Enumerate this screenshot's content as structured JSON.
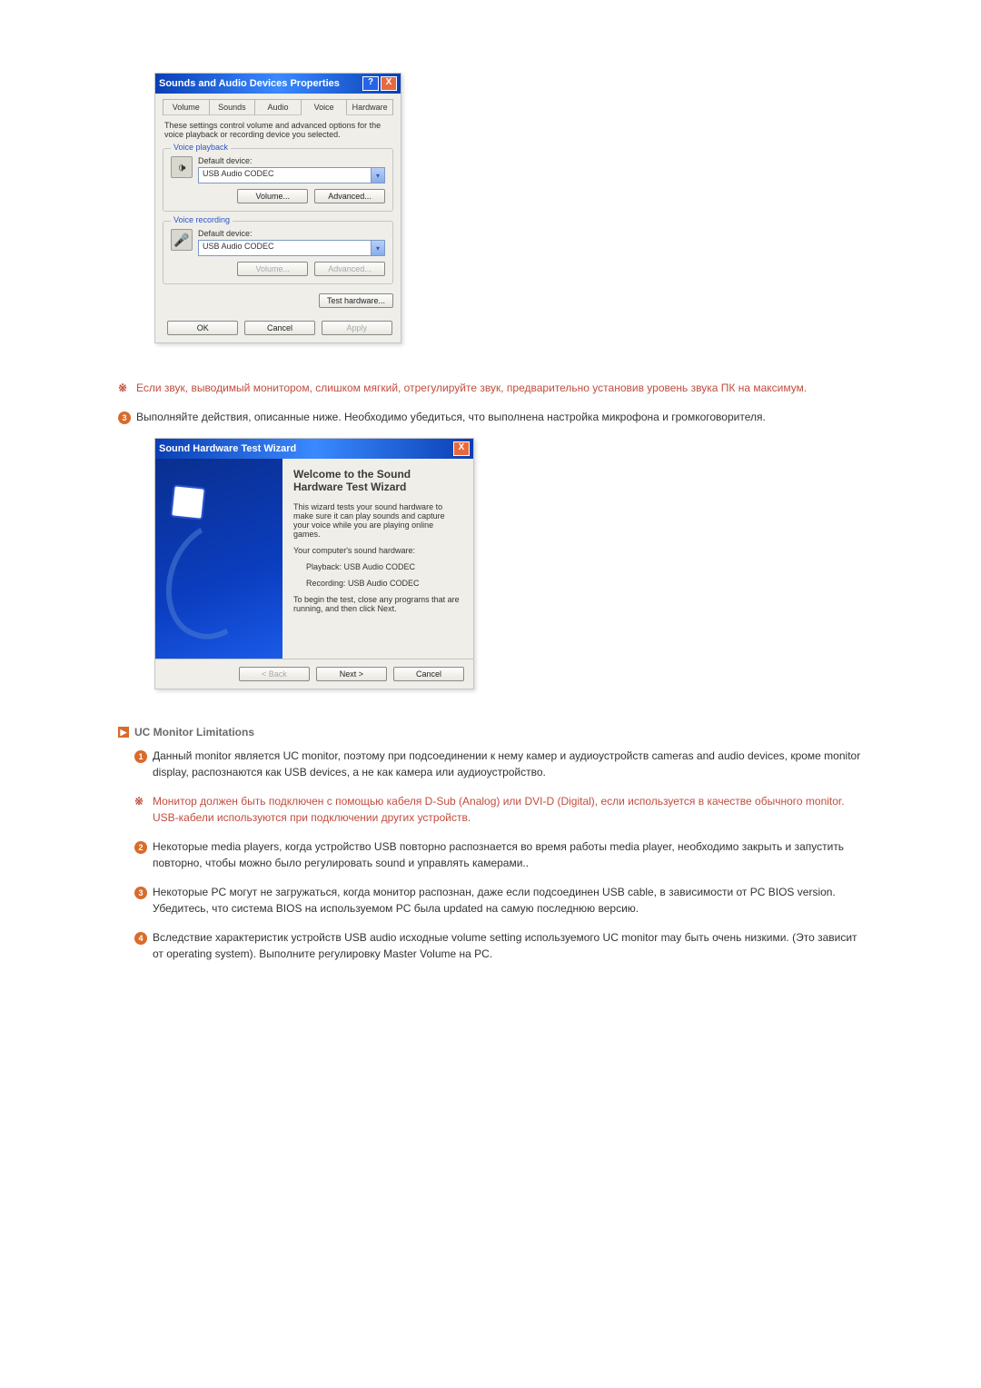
{
  "dialog1": {
    "title": "Sounds and Audio Devices Properties",
    "tabs": {
      "t0": "Volume",
      "t1": "Sounds",
      "t2": "Audio",
      "t3": "Voice",
      "t4": "Hardware"
    },
    "desc": "These settings control volume and advanced options for the voice playback or recording device you selected.",
    "sec_playback": {
      "legend": "Voice playback",
      "label": "Default device:",
      "value": "USB Audio CODEC",
      "btn_volume": "Volume...",
      "btn_advanced": "Advanced..."
    },
    "sec_recording": {
      "legend": "Voice recording",
      "label": "Default device:",
      "value": "USB Audio CODEC",
      "btn_volume": "Volume...",
      "btn_advanced": "Advanced..."
    },
    "test_hw": "Test hardware...",
    "ok": "OK",
    "cancel": "Cancel",
    "apply": "Apply"
  },
  "note_red_1": "Если звук, выводимый монитором, слишком мягкий, отрегулируйте звук, предварительно установив уровень звука ПК на максимум.",
  "step3": "Выполняйте действия, описанные ниже. Необходимо убедиться, что выполнена настройка микрофона и громкоговорителя.",
  "wizard": {
    "title": "Sound Hardware Test Wizard",
    "heading": "Welcome to the Sound Hardware Test Wizard",
    "p1": "This wizard tests your sound hardware to make sure it can play sounds and capture your voice while you are playing online games.",
    "p2": "Your computer's sound hardware:",
    "pb": "Playback:  USB Audio CODEC",
    "rc": "Recording:  USB Audio CODEC",
    "p3": "To begin the test, close any programs that are running, and then click Next.",
    "back": "< Back",
    "next": "Next >",
    "cancel": "Cancel"
  },
  "section_header": "UC Monitor Limitations",
  "limit1": "Данный monitor является UC monitor, поэтому при подсоединении к нему камер и аудиоустройств cameras and audio devices, кроме monitor display, распознаются как USB devices, а не как камера или аудиоустройство.",
  "limit_red": "Монитор должен быть подключен с помощью кабеля D-Sub (Analog) или DVI-D (Digital), если используется в качестве обычного monitor. USB-кабели используются при подключении других устройств.",
  "limit2": "Некоторые media players, когда устройство USB повторно распознается во время работы media player, необходимо закрыть и запустить повторно, чтобы можно было регулировать sound и управлять камерами..",
  "limit3": "Некоторые PC могут не загружаться, когда монитор распознан, даже если подсоединен USB cable, в зависимости от PC BIOS version.\nУбедитесь, что система BIOS на используемом PC была updated на самую последнюю версию.",
  "limit4": "Вследствие характеристик устройств USB audio исходные volume setting используемого UC monitor may быть очень низкими. (Это зависит от operating system). Выполните регулировку Master Volume на PC.",
  "icons": {
    "help": "?",
    "close": "X",
    "chevron": "▾",
    "arrow_right": "▶",
    "speaker": "🕩",
    "mic": "🎤"
  }
}
